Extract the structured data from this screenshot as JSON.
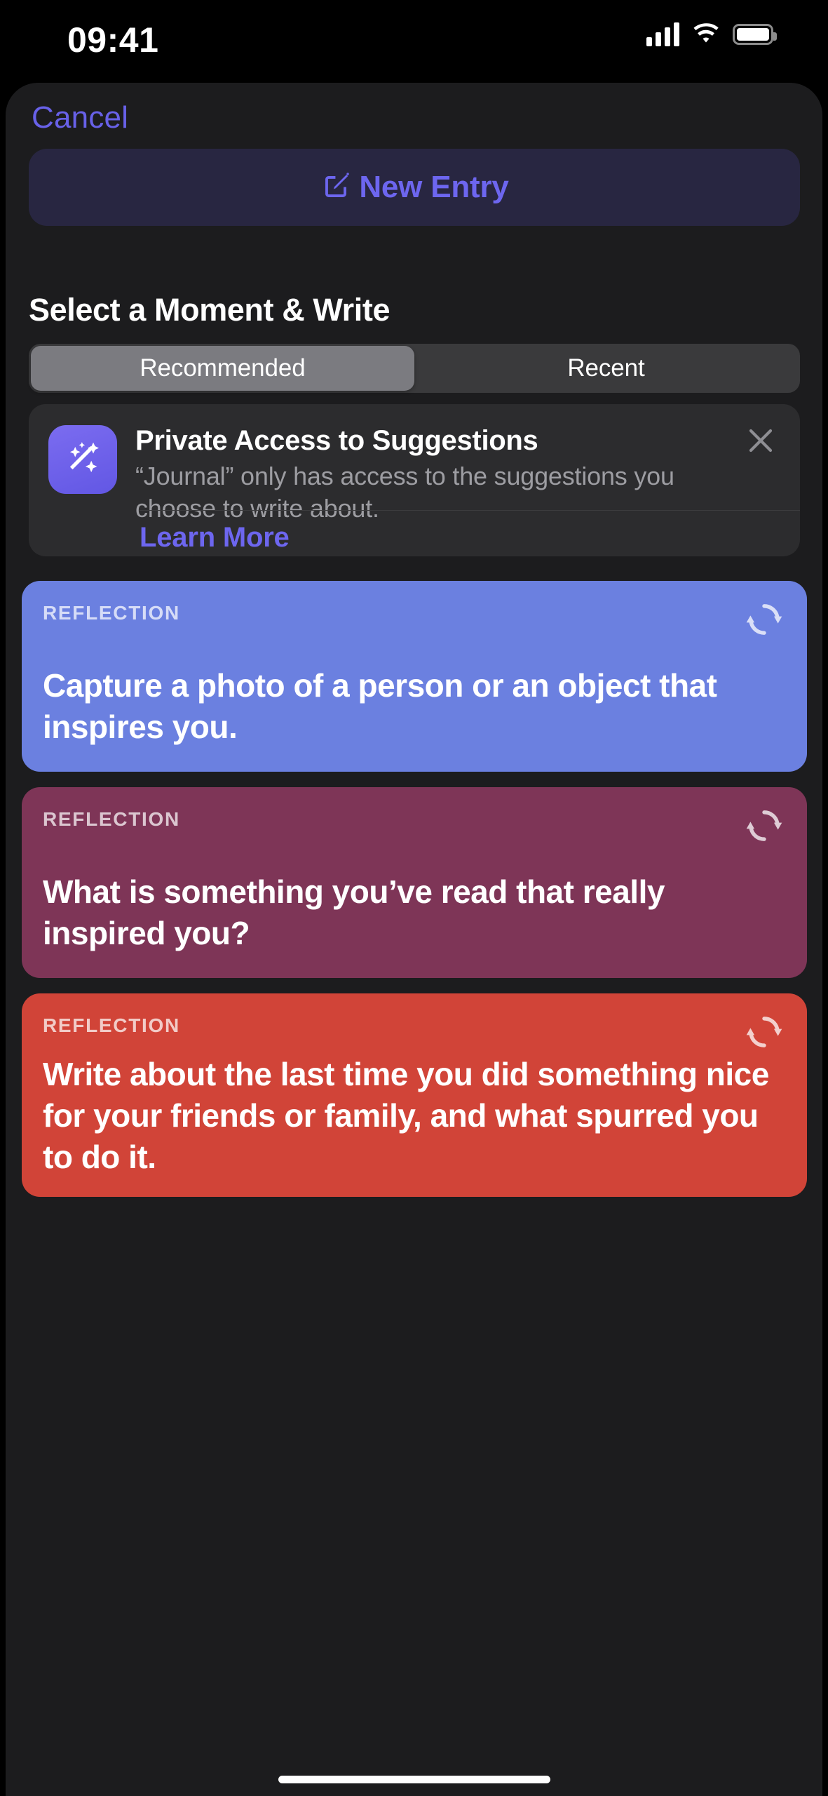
{
  "status_bar": {
    "time": "09:41",
    "cellular_icon": "cellular-bars-icon",
    "wifi_icon": "wifi-icon",
    "battery_icon": "battery-icon"
  },
  "sheet": {
    "cancel_label": "Cancel",
    "new_entry": {
      "label": "New Entry",
      "icon": "square-and-pencil-icon",
      "accent_color": "#6d66ef",
      "background_color": "#282641"
    },
    "section_title": "Select a Moment & Write",
    "segmented_control": {
      "options": [
        {
          "label": "Recommended",
          "selected": true
        },
        {
          "label": "Recent",
          "selected": false
        }
      ],
      "track_color": "#3a3a3c",
      "selected_color": "#7b7b80"
    },
    "privacy_card": {
      "icon": "magic-wand-sparkles-icon",
      "title": "Private Access to Suggestions",
      "body": "“Journal” only has access to the suggestions you choose to write about.",
      "learn_more_label": "Learn More",
      "close_icon": "close-x-icon",
      "link_color": "#6d66ef",
      "background_color": "#2c2c2e"
    },
    "suggestion_cards": [
      {
        "kicker": "REFLECTION",
        "text": "Capture a photo of a person or an object that inspires you.",
        "color": "#6b80e0",
        "refresh_icon": "refresh-arrows-icon"
      },
      {
        "kicker": "REFLECTION",
        "text": "What is something you’ve read that really inspired you?",
        "color": "#7e3557",
        "refresh_icon": "refresh-arrows-icon"
      },
      {
        "kicker": "REFLECTION",
        "text": "Write about the last time you did something nice for your friends or family, and what spurred you to do it.",
        "color": "#d14438",
        "refresh_icon": "refresh-arrows-icon"
      }
    ]
  },
  "home_indicator": "home-indicator"
}
